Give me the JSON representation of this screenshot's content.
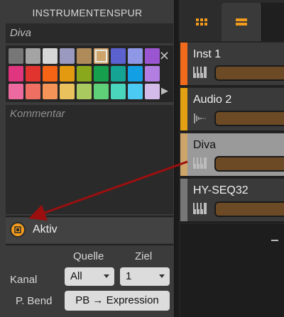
{
  "inspector": {
    "title": "INSTRUMENTENSPUR",
    "name_value": "Diva",
    "comment_placeholder": "Kommentar",
    "palette": {
      "close_glyph": "✕",
      "next_glyph": "▶",
      "selected_index": 5,
      "colors": [
        "#777777",
        "#a4a4a4",
        "#d7d7d7",
        "#9a9ac0",
        "#b08b5a",
        "#cda46a",
        "#5b61cf",
        "#8f98e6",
        "#9c55d1",
        "#e0357f",
        "#e2342f",
        "#f56414",
        "#e49a10",
        "#89a81c",
        "#169f4d",
        "#15a493",
        "#129fe3",
        "#b37ee2",
        "#ec6aa0",
        "#ef7062",
        "#f49458",
        "#e9c15d",
        "#a8ca5f",
        "#5fd077",
        "#4ad6bd",
        "#4bcbf3",
        "#d3bce9"
      ]
    },
    "activate": {
      "label": "Aktiv",
      "active": true
    },
    "routing": {
      "col_source": "Quelle",
      "col_target": "Ziel",
      "row_channel": "Kanal",
      "row_pbend": "P. Bend",
      "source_value": "All",
      "target_value": "1",
      "pbend_value": "PB → Expression"
    }
  },
  "tracks": {
    "items": [
      {
        "name": "Inst 1",
        "color": "#f26a1b",
        "icon": "piano-icon"
      },
      {
        "name": "Audio 2",
        "color": "#e3a012",
        "icon": "audio-wave-icon"
      },
      {
        "name": "Diva",
        "color": "#cda46a",
        "icon": "piano-icon",
        "selected": true
      },
      {
        "name": "HY-SEQ32",
        "color": "#777777",
        "icon": "piano-icon"
      }
    ],
    "accent": "#f39c1c"
  }
}
